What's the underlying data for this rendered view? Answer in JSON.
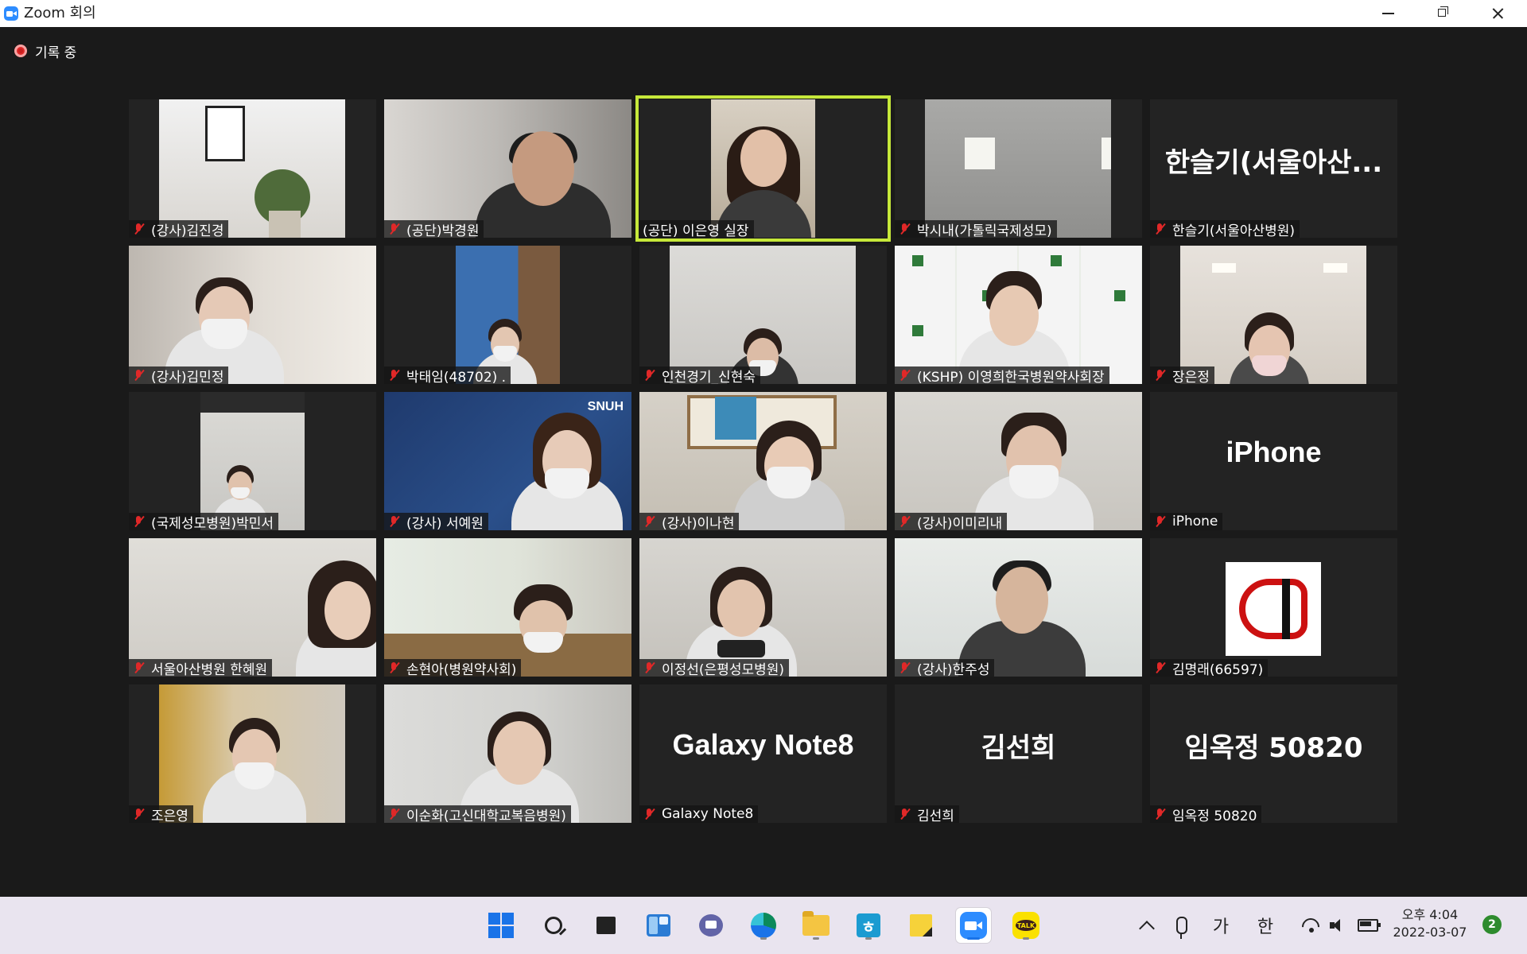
{
  "window": {
    "title": "Zoom 회의"
  },
  "recording": {
    "label": "기록 중"
  },
  "colors": {
    "speaking_border": "#c6e83a",
    "muted_icon": "#e02828",
    "meeting_bg": "#1a1a1a",
    "taskbar_bg": "#e9e4ef"
  },
  "participants": [
    {
      "name": "(강사)김진경",
      "muted": true,
      "video": true
    },
    {
      "name": "(공단)박경원",
      "muted": true,
      "video": true
    },
    {
      "name": "(공단) 이은영 실장",
      "muted": false,
      "video": true,
      "speaking": true
    },
    {
      "name": "박시내(가톨릭국제성모)",
      "muted": true,
      "video": true
    },
    {
      "name": "한슬기(서울아산병원)",
      "muted": true,
      "video": false,
      "card": "한슬기(서울아산..."
    },
    {
      "name": "(강사)김민정",
      "muted": true,
      "video": true
    },
    {
      "name": "박태임(48702) .",
      "muted": true,
      "video": true
    },
    {
      "name": "인천경기_신현숙",
      "muted": true,
      "video": true
    },
    {
      "name": "(KSHP) 이영희한국병원약사회장",
      "muted": true,
      "video": true
    },
    {
      "name": "장은정",
      "muted": true,
      "video": true
    },
    {
      "name": "(국제성모병원)박민서",
      "muted": true,
      "video": true
    },
    {
      "name": "(강사) 서예원",
      "muted": true,
      "video": true
    },
    {
      "name": "(강사)이나현",
      "muted": true,
      "video": true
    },
    {
      "name": "(강사)이미리내",
      "muted": true,
      "video": true
    },
    {
      "name": "iPhone",
      "muted": true,
      "video": false,
      "card": "iPhone"
    },
    {
      "name": "서울아산병원 한혜원",
      "muted": true,
      "video": true
    },
    {
      "name": "손현아(병원약사회)",
      "muted": true,
      "video": true
    },
    {
      "name": "이정선(은평성모병원)",
      "muted": true,
      "video": true
    },
    {
      "name": "(강사)한주성",
      "muted": true,
      "video": true
    },
    {
      "name": "김명래(66597)",
      "muted": true,
      "video": false,
      "logo": true
    },
    {
      "name": "조은영",
      "muted": true,
      "video": true
    },
    {
      "name": "이순화(고신대학교복음병원)",
      "muted": true,
      "video": true
    },
    {
      "name": "Galaxy Note8",
      "muted": true,
      "video": false,
      "card": "Galaxy Note8"
    },
    {
      "name": "김선희",
      "muted": true,
      "video": false,
      "card": "김선희"
    },
    {
      "name": "임옥정 50820",
      "muted": true,
      "video": false,
      "card": "임옥정 50820"
    }
  ],
  "taskbar": {
    "apps": [
      {
        "icon": "windows-start-icon",
        "active": false
      },
      {
        "icon": "search-icon",
        "active": false
      },
      {
        "icon": "task-view-icon",
        "active": false
      },
      {
        "icon": "widgets-icon",
        "active": false
      },
      {
        "icon": "teams-chat-icon",
        "active": false
      },
      {
        "icon": "edge-browser-icon",
        "active": false
      },
      {
        "icon": "file-explorer-icon",
        "active": false
      },
      {
        "icon": "hangul-word-icon",
        "active": false
      },
      {
        "icon": "sticky-notes-icon",
        "active": false
      },
      {
        "icon": "zoom-app-icon",
        "active": true
      },
      {
        "icon": "kakaotalk-icon",
        "active": false
      }
    ],
    "tray": {
      "ime_mode": "가",
      "ime_lang": "한",
      "time": "오후 4:04",
      "date": "2022-03-07",
      "notifications": "2"
    }
  }
}
